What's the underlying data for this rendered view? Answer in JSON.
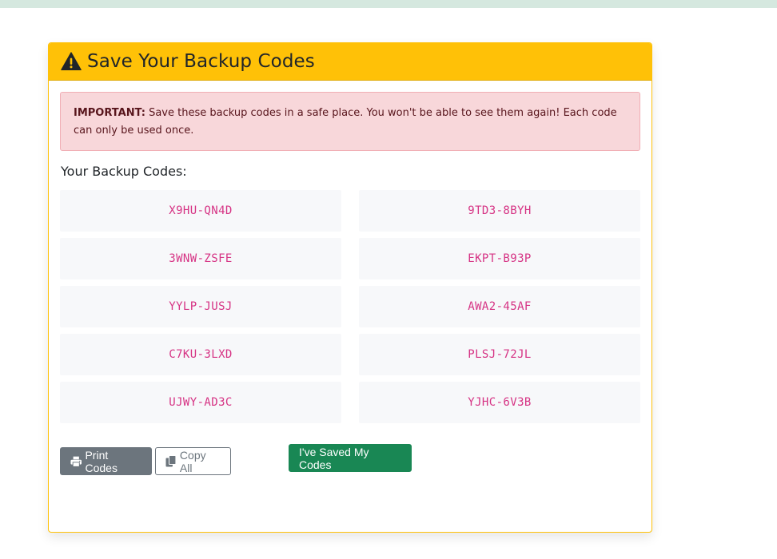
{
  "card": {
    "title": "Save Your Backup Codes",
    "header_icon": "warning-triangle-icon",
    "header_color": "#ffc107"
  },
  "alert": {
    "strong": "IMPORTANT:",
    "text": " Save these backup codes in a safe place. You won't be able to see them again! Each code can only be used once."
  },
  "codes_title": "Your Backup Codes:",
  "codes": [
    "X9HU-QN4D",
    "9TD3-8BYH",
    "3WNW-ZSFE",
    "EKPT-B93P",
    "YYLP-JUSJ",
    "AWA2-45AF",
    "C7KU-3LXD",
    "PLSJ-72JL",
    "UJWY-AD3C",
    "YJHC-6V3B"
  ],
  "buttons": {
    "print": "Print Codes",
    "copy": "Copy All",
    "saved": "I've Saved My Codes"
  },
  "colors": {
    "code_text": "#d63384",
    "success": "#198754",
    "secondary": "#6c757d"
  }
}
